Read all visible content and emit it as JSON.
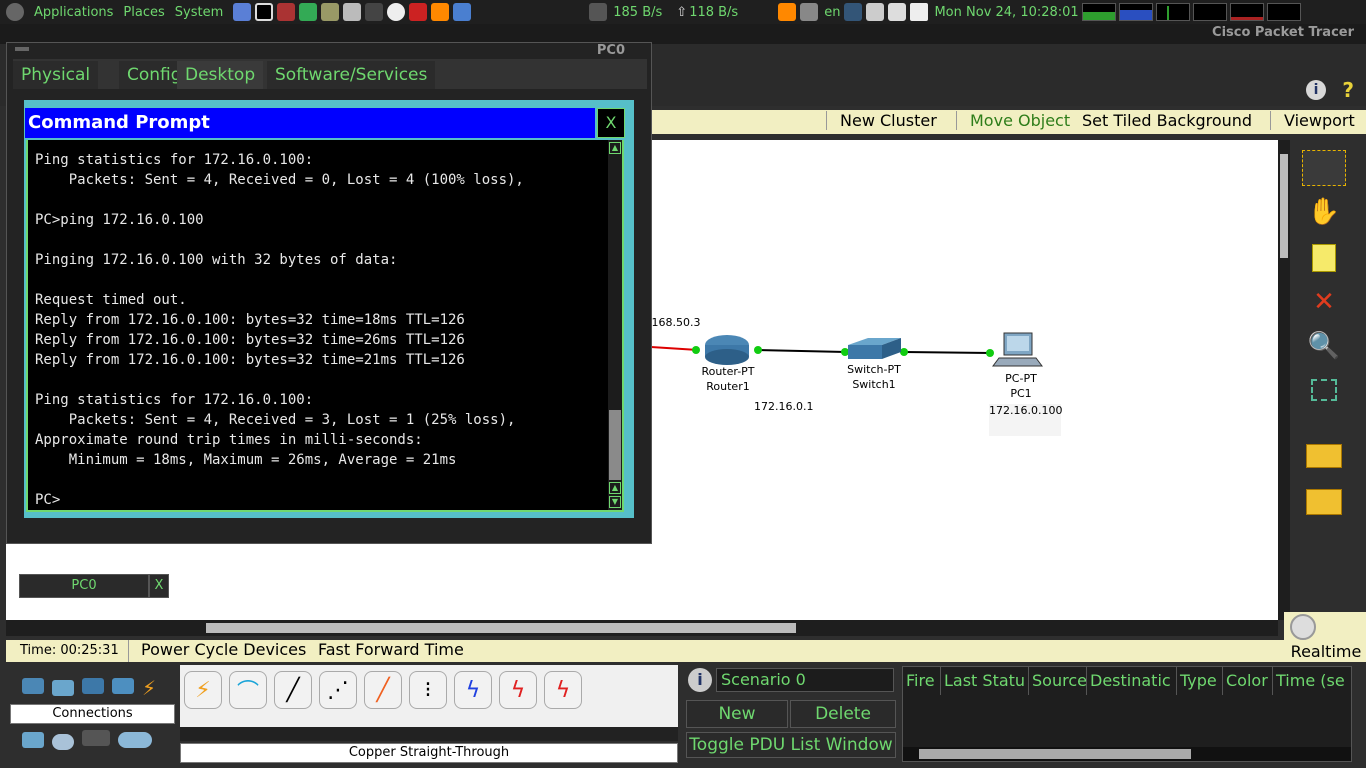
{
  "panel": {
    "menus": [
      "Applications",
      "Places",
      "System"
    ],
    "net_down": "185 B/s",
    "net_up": "118 B/s",
    "lang": "en",
    "clock": "Mon Nov 24, 10:28:01"
  },
  "app": {
    "title": "Cisco Packet Tracer"
  },
  "logical_toolbar": {
    "new_cluster": "New Cluster",
    "move_object": "Move Object",
    "set_tiled_background": "Set Tiled Background",
    "viewport": "Viewport"
  },
  "topology": {
    "partial_ip": ".168.50.3",
    "router": {
      "type": "Router-PT",
      "name": "Router1",
      "ip": "172.16.0.1"
    },
    "switch": {
      "type": "Switch-PT",
      "name": "Switch1"
    },
    "pc": {
      "type": "PC-PT",
      "name": "PC1",
      "ip": "172.16.0.100"
    }
  },
  "pc0_window": {
    "title": "PC0",
    "tabs": [
      "Physical",
      "Config",
      "Desktop",
      "Software/Services"
    ],
    "active_tab": "Desktop"
  },
  "cmd": {
    "title": "Command Prompt",
    "close": "X",
    "output": "Ping statistics for 172.16.0.100:\n    Packets: Sent = 4, Received = 0, Lost = 4 (100% loss),\n\nPC>ping 172.16.0.100\n\nPinging 172.16.0.100 with 32 bytes of data:\n\nRequest timed out.\nReply from 172.16.0.100: bytes=32 time=18ms TTL=126\nReply from 172.16.0.100: bytes=32 time=26ms TTL=126\nReply from 172.16.0.100: bytes=32 time=21ms TTL=126\n\nPing statistics for 172.16.0.100:\n    Packets: Sent = 4, Received = 3, Lost = 1 (25% loss),\nApproximate round trip times in milli-seconds:\n    Minimum = 18ms, Maximum = 26ms, Average = 21ms\n\nPC>"
  },
  "minimized": {
    "label": "PC0",
    "close": "X"
  },
  "status": {
    "time": "Time: 00:25:31",
    "power_cycle": "Power Cycle Devices",
    "fast_forward": "Fast Forward Time",
    "realtime": "Realtime"
  },
  "bottom": {
    "category": "Connections",
    "cable_selected": "Copper Straight-Through",
    "scenario": "Scenario 0",
    "new": "New",
    "delete": "Delete",
    "toggle_pdu": "Toggle PDU List Window",
    "pdu_columns": [
      "Fire",
      "Last Statu",
      "Source",
      "Destinatic",
      "Type",
      "Color",
      "Time (se"
    ]
  },
  "colors": {
    "accent_green": "#6fd86f",
    "cmd_title_blue": "#0000ff",
    "toolbar_yellow": "#f2efc2"
  }
}
